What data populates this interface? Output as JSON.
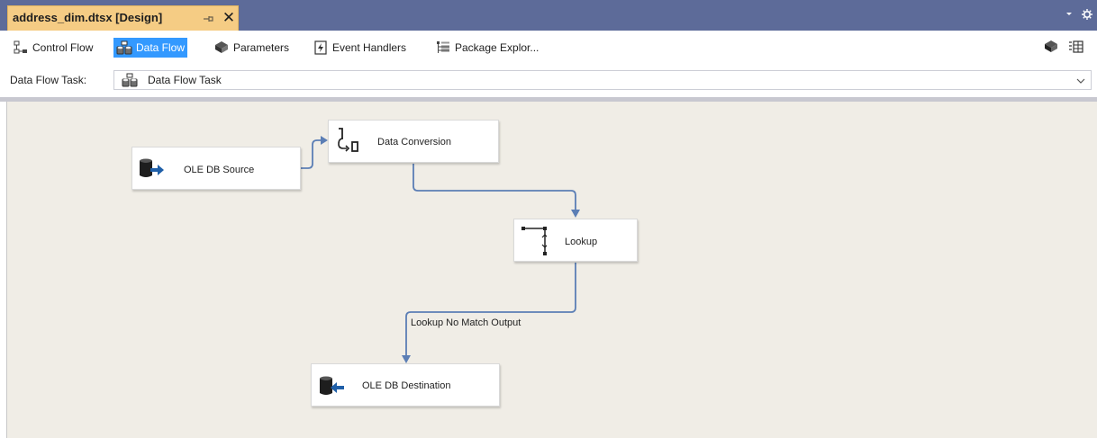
{
  "document_tab": {
    "title": "address_dim.dtsx [Design]",
    "pin_icon": "pin-icon",
    "close_icon": "close-icon"
  },
  "strip_buttons": [
    "dropdown-arrow-icon",
    "gear-icon"
  ],
  "designer_tabs": [
    {
      "label": "Control Flow",
      "icon": "control-flow-icon",
      "active": false
    },
    {
      "label": "Data Flow",
      "icon": "data-flow-icon",
      "active": true
    },
    {
      "label": "Parameters",
      "icon": "parameters-icon",
      "active": false
    },
    {
      "label": "Event Handlers",
      "icon": "event-handlers-icon",
      "active": false
    },
    {
      "label": "Package Explor...",
      "icon": "package-explorer-icon",
      "active": false
    }
  ],
  "toolbar_right": [
    "package-icon",
    "variables-grid-icon"
  ],
  "task_selector": {
    "label": "Data Flow Task:",
    "value": "Data Flow Task",
    "icon": "data-flow-task-icon"
  },
  "components": [
    {
      "id": "source",
      "label": "OLE DB Source",
      "icon": "ole-db-source-icon"
    },
    {
      "id": "conversion",
      "label": "Data Conversion",
      "icon": "data-conversion-icon"
    },
    {
      "id": "lookup",
      "label": "Lookup",
      "icon": "lookup-icon"
    },
    {
      "id": "destination",
      "label": "OLE DB Destination",
      "icon": "ole-db-destination-icon"
    }
  ],
  "paths": [
    {
      "from": "OLE DB Source",
      "to": "Data Conversion",
      "label": ""
    },
    {
      "from": "Data Conversion",
      "to": "Lookup",
      "label": ""
    },
    {
      "from": "Lookup",
      "to": "OLE DB Destination",
      "label": "Lookup No Match Output"
    }
  ],
  "colors": {
    "tab_strip": "#5d6b99",
    "active_document_tab": "#f5cc84",
    "active_designer_tab": "#3399ff",
    "canvas": "#f0ede6",
    "path_line": "#5b7eb5"
  }
}
